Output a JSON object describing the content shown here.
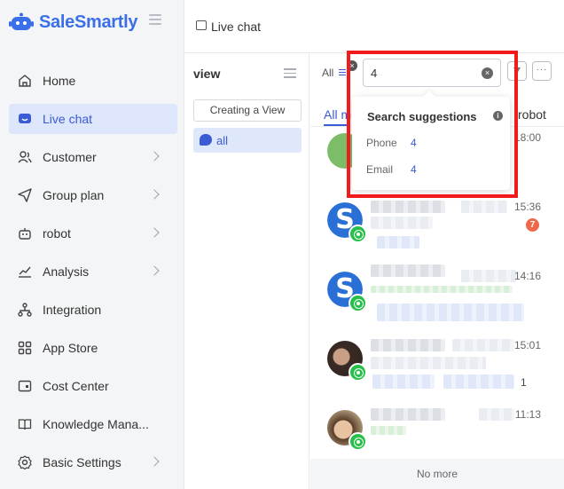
{
  "brand": {
    "name": "SaleSmartly",
    "color": "#3b6fe8"
  },
  "nav": {
    "items": [
      {
        "label": "Home",
        "icon": "home-icon"
      },
      {
        "label": "Live chat",
        "icon": "chat-icon",
        "active": true
      },
      {
        "label": "Customer",
        "icon": "users-icon"
      },
      {
        "label": "Group plan",
        "icon": "send-icon"
      },
      {
        "label": "robot",
        "icon": "robot-icon"
      },
      {
        "label": "Analysis",
        "icon": "analysis-icon"
      },
      {
        "label": "Integration",
        "icon": "integration-icon"
      },
      {
        "label": "App Store",
        "icon": "app-store-icon"
      },
      {
        "label": "Cost Center",
        "icon": "wallet-icon"
      },
      {
        "label": "Knowledge Mana...",
        "icon": "book-icon"
      },
      {
        "label": "Basic Settings",
        "icon": "gear-icon"
      }
    ]
  },
  "header": {
    "title": "Live chat"
  },
  "views": {
    "title": "view",
    "create_label": "Creating a View",
    "all_label": "all"
  },
  "chat_list": {
    "filter_all": "All",
    "tab_all": "All m",
    "tab_robot": "robot",
    "rows": [
      {
        "time": "18:00",
        "unread": ""
      },
      {
        "time": "15:36",
        "unread": "7"
      },
      {
        "time": "14:16",
        "unread": ""
      },
      {
        "time": "15:01",
        "unread": "",
        "tail": "1"
      },
      {
        "time": "11:13",
        "unread": ""
      }
    ],
    "no_more": "No more"
  },
  "search": {
    "value": "4",
    "suggestions_title": "Search suggestions",
    "suggestions": [
      {
        "label": "Phone",
        "count": "4"
      },
      {
        "label": "Email",
        "count": "4"
      }
    ]
  },
  "colors": {
    "accent": "#3a5bd4",
    "highlight": "#f21b1b",
    "whatsapp": "#27c04a"
  }
}
